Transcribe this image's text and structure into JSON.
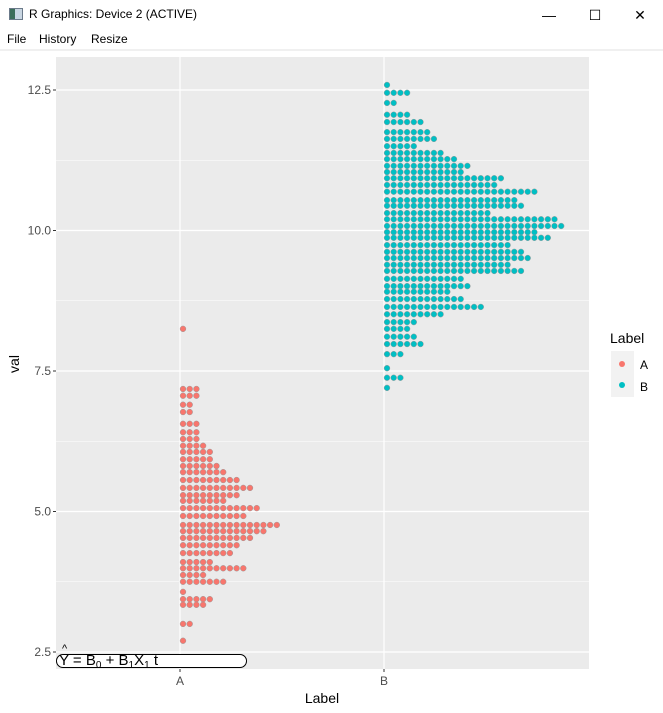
{
  "window": {
    "title": "R Graphics: Device 2 (ACTIVE)",
    "icon": "r-graphics-app-icon",
    "controls": {
      "minimize": "—",
      "maximize": "☐",
      "close": "✕"
    }
  },
  "menu": [
    "File",
    "History",
    "Resize"
  ],
  "annotation": {
    "hat": "^",
    "y": "Y",
    "eq": " = B",
    "sub0": "0",
    "plus": " + B",
    "sub1": "1",
    "x": "X",
    "sub1b": "1",
    "tail": "  t"
  },
  "chart_data": {
    "type": "dotplot",
    "title": "",
    "xlabel": "Label",
    "ylabel": "val",
    "categories": [
      "A",
      "B"
    ],
    "ylim": [
      2.25,
      13.1
    ],
    "yticks": [
      2.5,
      5.0,
      7.5,
      10.0,
      12.5
    ],
    "ytick_labels": [
      "2.5",
      "5.0",
      "7.5",
      "10.0",
      "12.5"
    ],
    "grid": true,
    "legend": {
      "title": "Label",
      "position": "right",
      "entries": [
        "A",
        "B"
      ]
    },
    "colors": {
      "A": "#F8766D",
      "B": "#00BFC4",
      "panel": "#EBEBEB",
      "grid": "#FFFFFF"
    },
    "series": [
      {
        "name": "A",
        "bins": [
          {
            "val": 8.25,
            "count": 1
          },
          {
            "val": 7.18,
            "count": 3
          },
          {
            "val": 7.06,
            "count": 3
          },
          {
            "val": 6.9,
            "count": 2
          },
          {
            "val": 6.77,
            "count": 2
          },
          {
            "val": 6.56,
            "count": 3
          },
          {
            "val": 6.41,
            "count": 3
          },
          {
            "val": 6.29,
            "count": 3
          },
          {
            "val": 6.17,
            "count": 4
          },
          {
            "val": 6.06,
            "count": 5
          },
          {
            "val": 5.93,
            "count": 5
          },
          {
            "val": 5.81,
            "count": 6
          },
          {
            "val": 5.7,
            "count": 7
          },
          {
            "val": 5.56,
            "count": 9
          },
          {
            "val": 5.42,
            "count": 11
          },
          {
            "val": 5.29,
            "count": 9
          },
          {
            "val": 5.19,
            "count": 7
          },
          {
            "val": 5.06,
            "count": 12
          },
          {
            "val": 4.92,
            "count": 10
          },
          {
            "val": 4.76,
            "count": 15
          },
          {
            "val": 4.65,
            "count": 13
          },
          {
            "val": 4.53,
            "count": 11
          },
          {
            "val": 4.4,
            "count": 9
          },
          {
            "val": 4.26,
            "count": 8
          },
          {
            "val": 4.1,
            "count": 5
          },
          {
            "val": 3.99,
            "count": 10
          },
          {
            "val": 3.87,
            "count": 4
          },
          {
            "val": 3.75,
            "count": 7
          },
          {
            "val": 3.57,
            "count": 1
          },
          {
            "val": 3.44,
            "count": 5
          },
          {
            "val": 3.34,
            "count": 4
          },
          {
            "val": 3.0,
            "count": 2
          },
          {
            "val": 2.7,
            "count": 1
          }
        ]
      },
      {
        "name": "B",
        "bins": [
          {
            "val": 12.59,
            "count": 1
          },
          {
            "val": 12.45,
            "count": 4
          },
          {
            "val": 12.27,
            "count": 2
          },
          {
            "val": 12.06,
            "count": 4
          },
          {
            "val": 11.93,
            "count": 6
          },
          {
            "val": 11.75,
            "count": 7
          },
          {
            "val": 11.63,
            "count": 8
          },
          {
            "val": 11.5,
            "count": 5
          },
          {
            "val": 11.38,
            "count": 9
          },
          {
            "val": 11.27,
            "count": 11
          },
          {
            "val": 11.15,
            "count": 13
          },
          {
            "val": 11.04,
            "count": 12
          },
          {
            "val": 10.93,
            "count": 18
          },
          {
            "val": 10.81,
            "count": 17
          },
          {
            "val": 10.69,
            "count": 23
          },
          {
            "val": 10.54,
            "count": 20
          },
          {
            "val": 10.44,
            "count": 21
          },
          {
            "val": 10.31,
            "count": 16
          },
          {
            "val": 10.2,
            "count": 26
          },
          {
            "val": 10.08,
            "count": 27
          },
          {
            "val": 9.97,
            "count": 23
          },
          {
            "val": 9.87,
            "count": 25
          },
          {
            "val": 9.74,
            "count": 19
          },
          {
            "val": 9.62,
            "count": 21
          },
          {
            "val": 9.51,
            "count": 22
          },
          {
            "val": 9.39,
            "count": 19
          },
          {
            "val": 9.28,
            "count": 21
          },
          {
            "val": 9.14,
            "count": 12
          },
          {
            "val": 9.01,
            "count": 13
          },
          {
            "val": 8.91,
            "count": 10
          },
          {
            "val": 8.78,
            "count": 12
          },
          {
            "val": 8.64,
            "count": 15
          },
          {
            "val": 8.51,
            "count": 9
          },
          {
            "val": 8.37,
            "count": 5
          },
          {
            "val": 8.25,
            "count": 4
          },
          {
            "val": 8.11,
            "count": 5
          },
          {
            "val": 7.98,
            "count": 6
          },
          {
            "val": 7.8,
            "count": 3
          },
          {
            "val": 7.55,
            "count": 1
          },
          {
            "val": 7.38,
            "count": 3
          },
          {
            "val": 7.2,
            "count": 1
          }
        ]
      }
    ]
  }
}
